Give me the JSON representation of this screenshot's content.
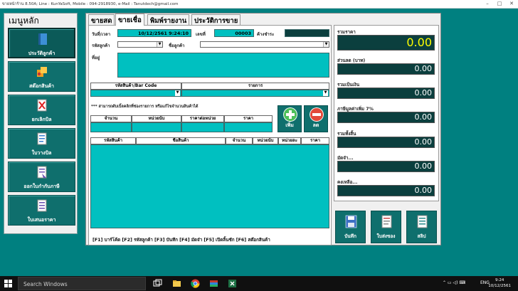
{
  "window": {
    "title": "ขายหน้าร้าน 8.50A; Line : KunYaSoft, Mobile : 094-2918930, e-Mail : Tanutdech@gmail.com"
  },
  "menu": {
    "title": "เมนูหลัก",
    "items": [
      {
        "label": "ประวัติลูกค้า",
        "icon": "customer-book-icon"
      },
      {
        "label": "สต๊อกสินค้า",
        "icon": "stock-boxes-icon"
      },
      {
        "label": "ยกเลิกบิล",
        "icon": "cancel-bill-icon"
      },
      {
        "label": "ใบวางบิล",
        "icon": "billing-document-icon"
      },
      {
        "label": "ออกใบกำกับภาษี",
        "icon": "tax-invoice-icon"
      },
      {
        "label": "ใบเสนอราคา",
        "icon": "quotation-icon"
      }
    ]
  },
  "tabs": [
    "ขายสด",
    "ขายเชื่อ",
    "พิมพ์รายงาน",
    "ประวัติการขาย"
  ],
  "form": {
    "date_label": "วันที่/เวลา",
    "date_value": "10/12/2561 9:24:10",
    "number_label": "เลขที่",
    "number_value": "00003",
    "outstanding_label": "ค้างชำระ",
    "outstanding_value": "",
    "customer_code_label": "รหัสลูกค้า",
    "customer_code_value": "",
    "customer_name_label": "ชื่อลูกค้า",
    "customer_name_value": "",
    "address_label": "ที่อยู่",
    "address_value": "",
    "product_code_header": "รหัสสินค้า/Bar Code",
    "item_header": "รายการ",
    "product_code_value": "",
    "item_value": "",
    "note": "*** สามารถดับเบิ้ลคลิกที่ช่องรายการ หรือแก้ไขจำนวนสินค้าได้",
    "entry_headers": [
      "จำนวน",
      "หน่วยนับ",
      "ราคาต่อหน่วย",
      "ราคา"
    ],
    "entry_values": [
      "",
      "",
      "",
      ""
    ],
    "add_label": "เพิ่ม",
    "delete_label": "ลด",
    "table_headers": [
      "รหัสสินค้า",
      "ชื่อสินค้า",
      "จำนวน",
      "หน่วยนับ",
      "หน่วยละ",
      "ราคา"
    ],
    "shortcuts": "[F1] บาร์โค้ด [F2] รหัสลูกค้า [F3] บันทึก [F4] มัดจำ [F5] เปิดลิ้นชัก [F6] สต๊อกสินค้า"
  },
  "totals": [
    {
      "label": "รวมราคา",
      "value": "0.00"
    },
    {
      "label": "ส่วนลด (บาท)",
      "value": "0.00"
    },
    {
      "label": "รวมเป็นเงิน",
      "value": "0.00"
    },
    {
      "label": "ภาษีมูลค่าเพิ่ม 7%",
      "value": "0.00"
    },
    {
      "label": "รวมทั้งสิ้น",
      "value": "0.00"
    },
    {
      "label": "มัดจำ...",
      "value": "0.00"
    },
    {
      "label": "คงเหลือ...",
      "value": "0.00"
    }
  ],
  "actions": [
    {
      "label": "บันทึก",
      "icon": "save-disk-icon"
    },
    {
      "label": "ใบส่งของ",
      "icon": "delivery-note-icon"
    },
    {
      "label": "สลิป",
      "icon": "slip-receipt-icon"
    }
  ],
  "taskbar": {
    "search_placeholder": "Search Windows",
    "language": "ENG",
    "time": "9:24",
    "date": "10/12/2561"
  },
  "colors": {
    "background": "#008080",
    "field_cyan": "#00C0C0",
    "field_dark": "#0B3F3E",
    "button_teal": "#0F6F6D",
    "total_big_value": "#FFFF00"
  }
}
